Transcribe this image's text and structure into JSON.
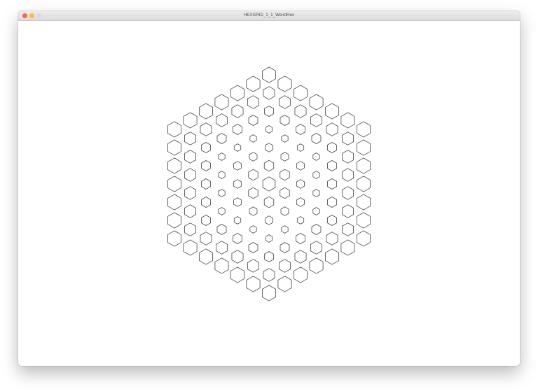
{
  "window": {
    "title": "HEXGRID_1_1_WeirdHex",
    "controls": {
      "close_color": "#fe5f57",
      "minimize_color": "#febc2e",
      "zoom_color": "#d9d9d9"
    }
  },
  "canvas": {
    "background": "#ffffff",
    "stroke_color": "#444444",
    "grid_rings": 6,
    "ring_size_ratio": [
      0.68,
      0.52,
      0.42,
      0.36,
      0.5,
      0.62,
      0.74
    ]
  }
}
